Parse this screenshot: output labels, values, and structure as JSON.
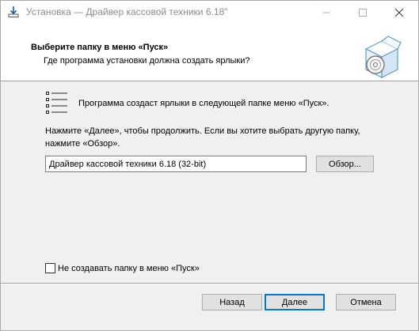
{
  "window": {
    "title": "Установка — Драйвер кассовой техники  6.18\"",
    "icons": [
      "installer-icon",
      "minimize-icon",
      "maximize-icon",
      "close-icon"
    ]
  },
  "header": {
    "title": "Выберите папку в меню «Пуск»",
    "subtitle": "Где программа установки должна создать ярлыки?",
    "graphic": "box-disc-icon"
  },
  "body": {
    "info": "Программа создаст ярлыки в следующей папке меню «Пуск».",
    "instructions": "Нажмите «Далее», чтобы продолжить. Если вы хотите выбрать другую папку, нажмите «Обзор».",
    "folder_value": "Драйвер кассовой техники 6.18 (32-bit)",
    "browse_label": "Обзор...",
    "checkbox_label": "Не создавать папку в меню «Пуск»",
    "checkbox_checked": false
  },
  "footer": {
    "back_label": "Назад",
    "next_label": "Далее",
    "cancel_label": "Отмена"
  },
  "colors": {
    "accent": "#0078d7",
    "face": "#f0f0f0",
    "button": "#e1e1e1"
  }
}
